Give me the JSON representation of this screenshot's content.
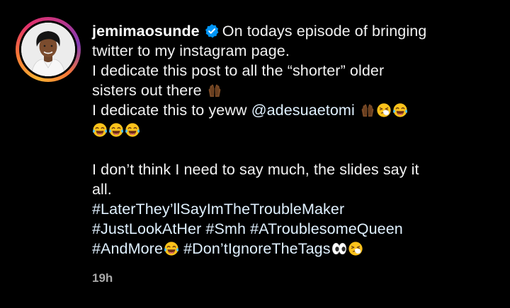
{
  "post": {
    "username": "jemimaosunde",
    "line1_text": "On todays episode of bringing",
    "line2_text": "twitter to my instagram page.",
    "line3_text": "I dedicate this post to all the “shorter” older",
    "line4_text": "sisters out there",
    "line5_text": "I dedicate this to yeww",
    "mention": "@adesuaetomi",
    "line7_text": "I don’t think I need to say much, the slides say it",
    "line8_text": "all.",
    "hashtag1": "#LaterThey’llSayImTheTroubleMaker",
    "hashtag2": "#JustLookAtHer",
    "hashtag3": "#Smh",
    "hashtag4": "#ATroublesomeQueen",
    "hashtag5": "#AndMore",
    "hashtag6": "#Don’tIgnoreTheTags",
    "timestamp": "19h"
  },
  "icons": {
    "verified": "verified-badge-icon",
    "raised_hands": "raised-hands-emoji",
    "sneezing": "sneezing-face-emoji",
    "laughing": "tears-of-joy-emoji",
    "eyes": "eyes-emoji"
  },
  "colors": {
    "background": "#000000",
    "text": "#f2f2f2",
    "link": "#e0f1ff",
    "timestamp": "#a8a8a8",
    "verified": "#0095f6"
  }
}
